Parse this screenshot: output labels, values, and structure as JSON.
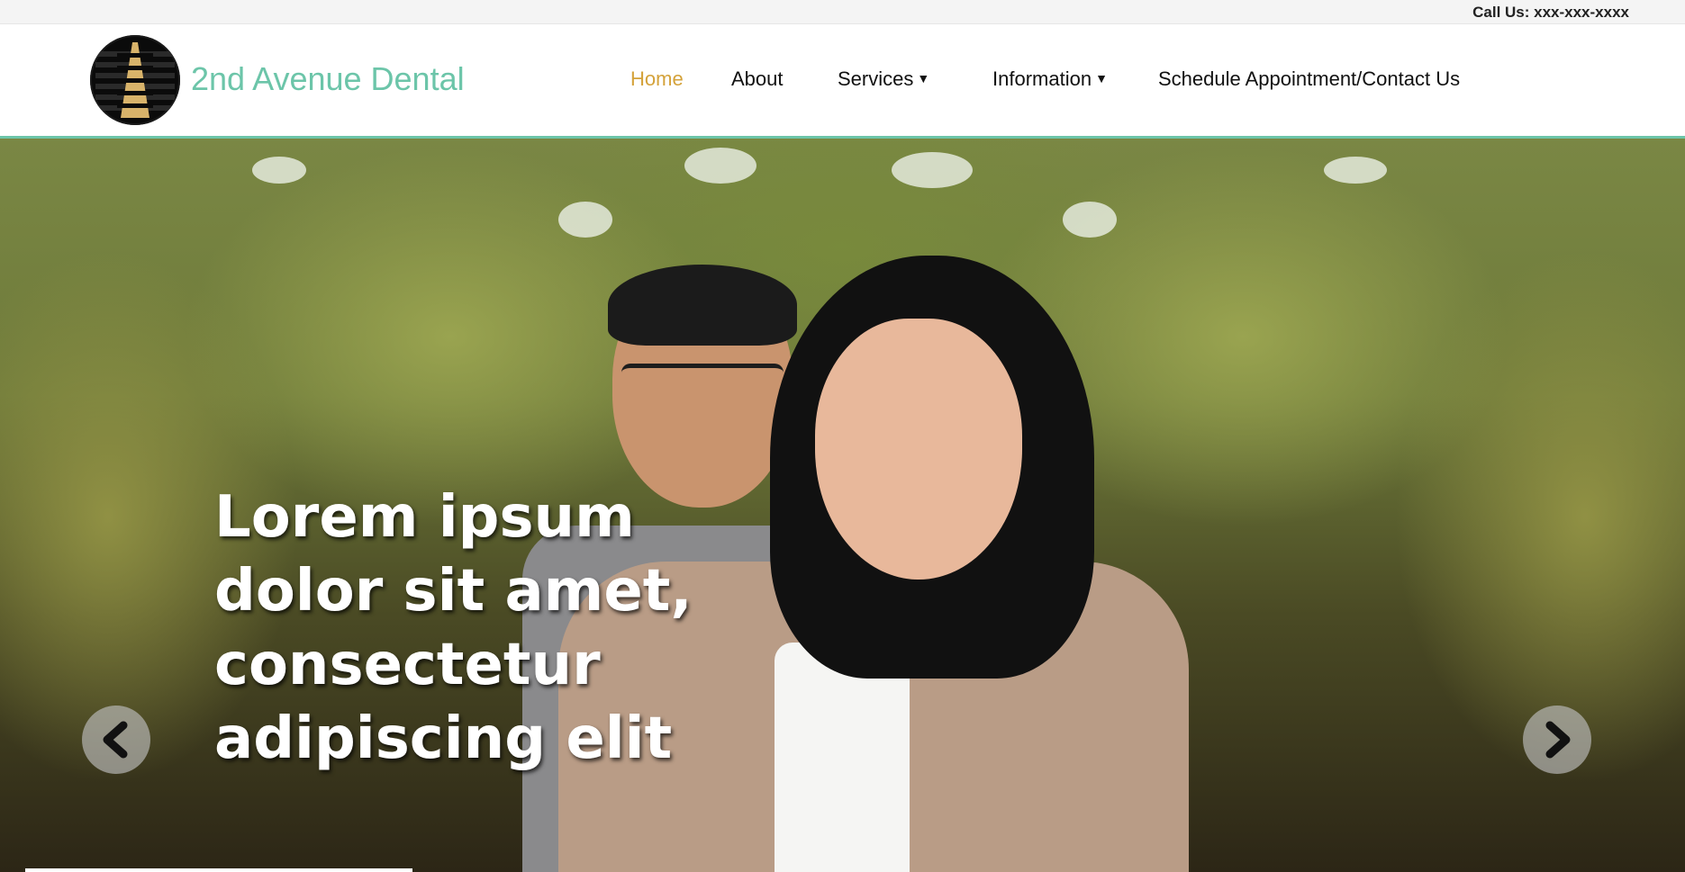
{
  "topbar": {
    "call_text": "Call Us: xxx-xxx-xxxx"
  },
  "header": {
    "brand": "2nd Avenue Dental",
    "logo_icon": "avenue-road-logo-icon",
    "nav": [
      {
        "label": "Home",
        "active": true
      },
      {
        "label": "About",
        "active": false
      },
      {
        "label": "Services",
        "dropdown": true
      },
      {
        "label": "Information",
        "dropdown": true
      },
      {
        "label": "Schedule Appointment/Contact Us",
        "active": false
      }
    ],
    "caret_glyph": "▼",
    "accent_color": "#6cc5a9",
    "active_color": "#d4a23a"
  },
  "hero": {
    "headline": "Lorem ipsum dolor sit amet, consectetur adipiscing elit",
    "prev_icon": "chevron-left-icon",
    "next_icon": "chevron-right-icon"
  }
}
